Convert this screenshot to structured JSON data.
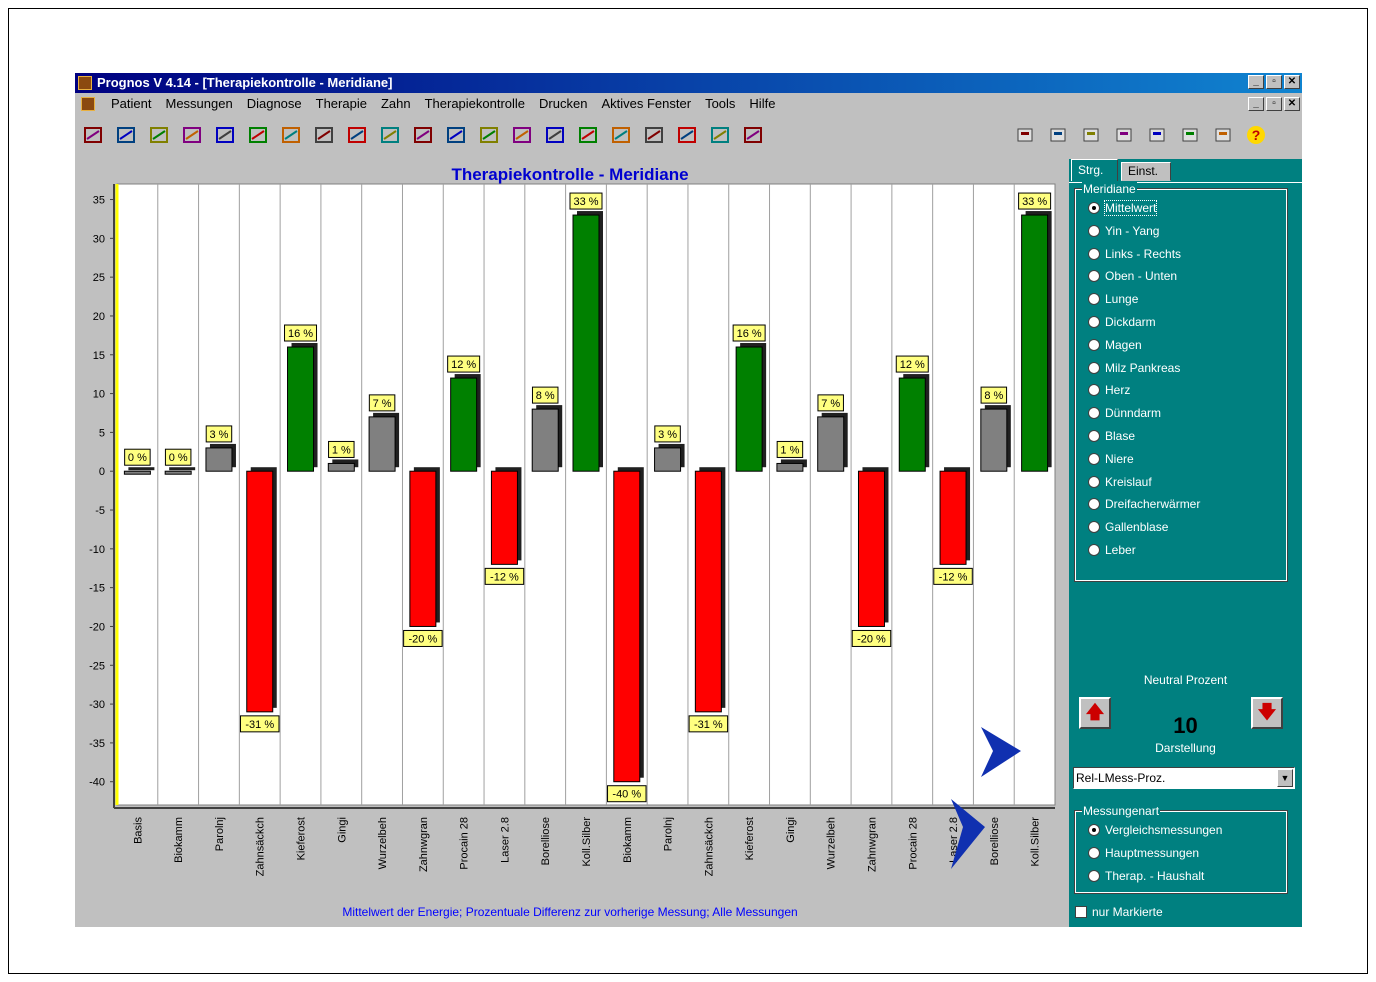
{
  "window": {
    "title": "Prognos V 4.14 - [Therapiekontrolle - Meridiane]",
    "min_glyph": "_",
    "restore_glyph": "▫",
    "close_glyph": "✕"
  },
  "menu": [
    "Patient",
    "Messungen",
    "Diagnose",
    "Therapie",
    "Zahn",
    "Therapiekontrolle",
    "Drucken",
    "Aktives Fenster",
    "Tools",
    "Hilfe"
  ],
  "toolbar": {
    "left_icons": [
      "open-icon",
      "table-icon",
      "line-chart-icon",
      "bar-chart-icon",
      "list-icon",
      "circle-icon",
      "scatter-icon",
      "stripes-icon",
      "grid-icon",
      "arrow-icon",
      "gauge-icon",
      "columns-icon",
      "area-chart-icon",
      "crosshair-chart-icon",
      "pencil-h-icon",
      "pencil-v-icon",
      "pencil-e-icon",
      "print-icon",
      "transfer-icon",
      "clipboard-icon",
      "figure-icon"
    ],
    "right_icons": [
      "print-right-icon",
      "print-preview-icon",
      "report-icon",
      "export-icon",
      "help-query-icon",
      "compare-icon",
      "settings-icon",
      "help-icon"
    ]
  },
  "chart_data": {
    "type": "bar",
    "title": "Therapiekontrolle - Meridiane",
    "subtitle": "Mittelwert der Energie;  Prozentuale Differenz zur vorherige Messung;  Alle Messungen",
    "categories": [
      "Basis",
      "Biokamm",
      "Parolnj",
      "Zahnsäckch",
      "Kieferost",
      "Gingi",
      "Wurzelbeh",
      "Zahnwgran",
      "Procain 28",
      "Laser 2.8",
      "Borelliose",
      "Koll.Silber",
      "Biokamm",
      "Parolnj",
      "Zahnsäckch",
      "Kieferost",
      "Gingi",
      "Wurzelbeh",
      "Zahnwgran",
      "Procain 28",
      "Laser 2.8",
      "Borelliose",
      "Koll.Silber"
    ],
    "values": [
      0,
      0,
      3,
      -31,
      16,
      1,
      7,
      -20,
      12,
      -12,
      8,
      33,
      -40,
      3,
      -31,
      16,
      1,
      7,
      -20,
      12,
      -12,
      8,
      33
    ],
    "labels": [
      "0 %",
      "0 %",
      "3 %",
      "-31 %",
      "16 %",
      "1 %",
      "7 %",
      "-20 %",
      "12 %",
      "-12 %",
      "8 %",
      "33 %",
      "-40 %",
      "3 %",
      "-31 %",
      "16 %",
      "1 %",
      "7 %",
      "-20 %",
      "12 %",
      "-12 %",
      "8 %",
      "33 %"
    ],
    "ylim": [
      -43,
      37
    ],
    "yticks": [
      35,
      30,
      25,
      20,
      15,
      10,
      5,
      0,
      -5,
      -10,
      -15,
      -20,
      -25,
      -30,
      -35,
      -40
    ],
    "neutral_percent": 10,
    "colors": {
      "positive": "#008000",
      "neutral": "#808080",
      "negative": "#ff0000",
      "label_bg": "#ffff80"
    },
    "grid": true
  },
  "panel": {
    "tabs": [
      "Strg.",
      "Einst."
    ],
    "meridiane_legend": "Meridiane",
    "meridiane": [
      "Mittelwert",
      "Yin - Yang",
      "Links - Rechts",
      "Oben - Unten",
      "Lunge",
      "Dickdarm",
      "Magen",
      "Milz Pankreas",
      "Herz",
      "Dünndarm",
      "Blase",
      "Niere",
      "Kreislauf",
      "Dreifacherwärmer",
      "Gallenblase",
      "Leber"
    ],
    "neutral_label": "Neutral Prozent",
    "neutral_value": "10",
    "darstellung_label": "Darstellung",
    "darstellung_value": "Rel-LMess-Proz.",
    "messungenart_legend": "Messungenart",
    "messungenart": [
      "Vergleichsmessungen",
      "Hauptmessungen",
      "Therap. - Haushalt"
    ],
    "nur_markierte": "nur Markierte"
  }
}
